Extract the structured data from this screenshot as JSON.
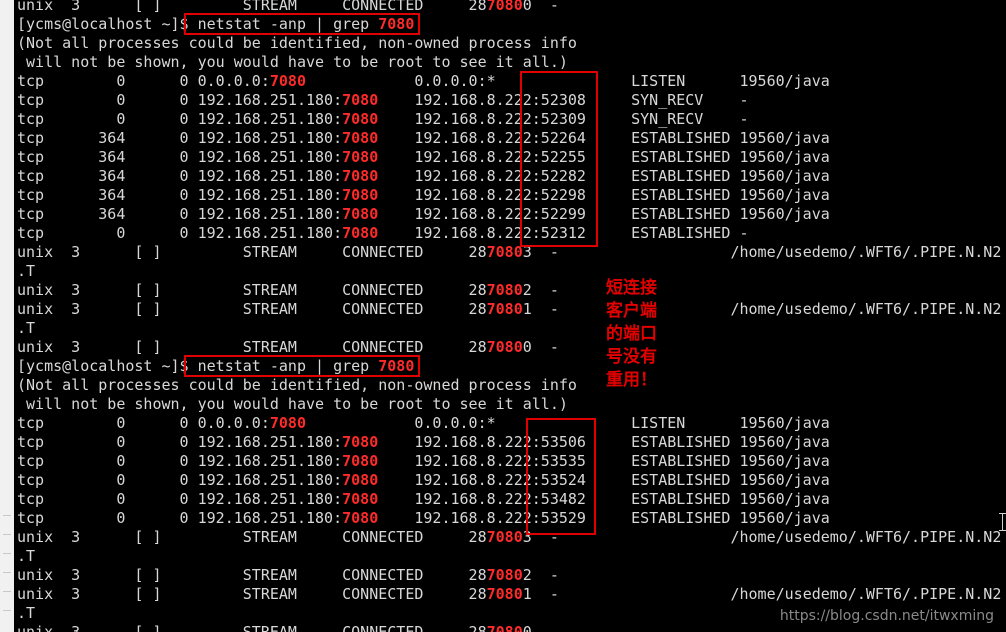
{
  "terminal": {
    "lines": [
      "unix  3      [ ]         STREAM     CONNECTED     2870800  -",
      "[ycms@localhost ~]$ netstat -anp | grep 7080",
      "(Not all processes could be identified, non-owned process info",
      " will not be shown, you would have to be root to see it all.)",
      "tcp        0      0 0.0.0.0:7080            0.0.0.0:*               LISTEN      19560/java",
      "tcp        0      0 192.168.251.180:7080    192.168.8.222:52308     SYN_RECV    -",
      "tcp        0      0 192.168.251.180:7080    192.168.8.222:52309     SYN_RECV    -",
      "tcp      364      0 192.168.251.180:7080    192.168.8.222:52264     ESTABLISHED 19560/java",
      "tcp      364      0 192.168.251.180:7080    192.168.8.222:52255     ESTABLISHED 19560/java",
      "tcp      364      0 192.168.251.180:7080    192.168.8.222:52282     ESTABLISHED 19560/java",
      "tcp      364      0 192.168.251.180:7080    192.168.8.222:52298     ESTABLISHED 19560/java",
      "tcp      364      0 192.168.251.180:7080    192.168.8.222:52299     ESTABLISHED 19560/java",
      "tcp        0      0 192.168.251.180:7080    192.168.8.222:52312     ESTABLISHED -",
      "unix  3      [ ]         STREAM     CONNECTED     2870803  -                   /home/usedemo/.WFT6/.PIPE.N.N2",
      ".T",
      "unix  3      [ ]         STREAM     CONNECTED     2870802  -",
      "unix  3      [ ]         STREAM     CONNECTED     2870801  -                   /home/usedemo/.WFT6/.PIPE.N.N2",
      ".T",
      "unix  3      [ ]         STREAM     CONNECTED     2870800  -",
      "[ycms@localhost ~]$ netstat -anp | grep 7080",
      "(Not all processes could be identified, non-owned process info",
      " will not be shown, you would have to be root to see it all.)",
      "tcp        0      0 0.0.0.0:7080            0.0.0.0:*               LISTEN      19560/java",
      "tcp        0      0 192.168.251.180:7080    192.168.8.222:53506     ESTABLISHED 19560/java",
      "tcp        0      0 192.168.251.180:7080    192.168.8.222:53535     ESTABLISHED 19560/java",
      "tcp        0      0 192.168.251.180:7080    192.168.8.222:53524     ESTABLISHED 19560/java",
      "tcp        0      0 192.168.251.180:7080    192.168.8.222:53482     ESTABLISHED 19560/java",
      "tcp        0      0 192.168.251.180:7080    192.168.8.222:53529     ESTABLISHED 19560/java",
      "unix  3      [ ]         STREAM     CONNECTED     2870803  -                   /home/usedemo/.WFT6/.PIPE.N.N2",
      ".T",
      "unix  3      [ ]         STREAM     CONNECTED     2870802  -",
      "unix  3      [ ]         STREAM     CONNECTED     2870801  -                   /home/usedemo/.WFT6/.PIPE.N.N2",
      ".T",
      "unix  3      [ ]         STREAM     CONNECTED     2870800  -"
    ],
    "highlight_term": "7080",
    "cursor_icon": "i-beam-cursor-icon"
  },
  "annotation": {
    "lines": [
      "短连接",
      "客户端",
      "的端口",
      "号没有",
      "重用！"
    ]
  },
  "watermark": "https://blog.csdn.net/itwxming",
  "colors": {
    "background": "#000000",
    "text": "#d8d8d8",
    "highlight": "#ff2b2b",
    "box": "#e00000",
    "annotation": "#e30000"
  }
}
